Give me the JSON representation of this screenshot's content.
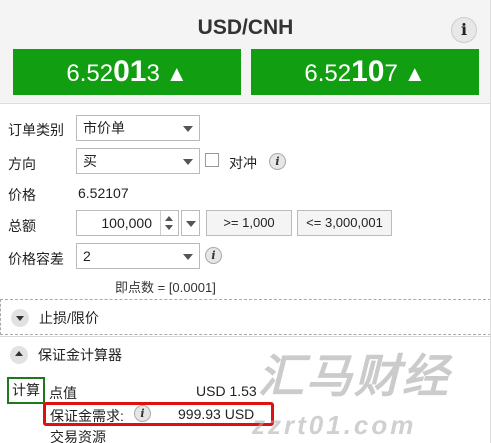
{
  "header": {
    "title": "USD/CNH",
    "info_icon": "i"
  },
  "quotes": {
    "sell": {
      "prefix": "6.52",
      "big": "01",
      "suffix": "3",
      "arrow": "▲"
    },
    "buy": {
      "prefix": "6.52",
      "big": "10",
      "suffix": "7",
      "arrow": "▲"
    },
    "color": "#119e11"
  },
  "form": {
    "order_type_label": "订单类别",
    "order_type_value": "市价单",
    "direction_label": "方向",
    "direction_value": "买",
    "hedge_label": "对冲",
    "price_label": "价格",
    "price_value": "6.52107",
    "amount_label": "总额",
    "amount_value": "100,000",
    "amount_min": ">= 1,000",
    "amount_max": "<= 3,000,001",
    "tolerance_label": "价格容差",
    "tolerance_value": "2",
    "pip_note": "即点数 = [0.0001]"
  },
  "sections": {
    "stop_limit": "止损/限价",
    "margin_calc": "保证金计算器"
  },
  "calculator": {
    "calc_button": "计算",
    "pip_value_label": "点值",
    "pip_value": "USD 1.53",
    "margin_label": "保证金需求:",
    "margin_value": "999.93 USD",
    "trade_resources": "交易资源"
  },
  "watermark": {
    "line1": "汇马财经",
    "line2": "zzrt01.com"
  },
  "colors": {
    "accent_green": "#119e11",
    "highlight_red": "#e01010"
  }
}
